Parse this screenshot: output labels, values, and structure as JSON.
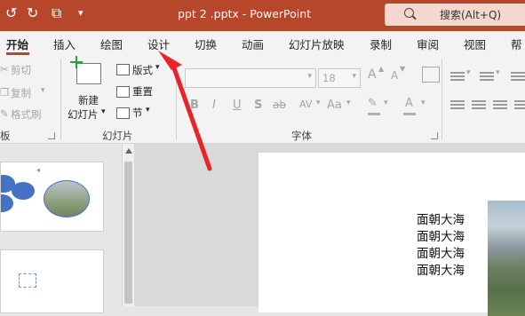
{
  "titlebar": {
    "title": "ppt 2 .pptx  -  PowerPoint",
    "search_label": "搜索(Alt+Q)",
    "save_icon": "save-icon",
    "redo_icon": "redo-icon",
    "present_icon": "present-from-start-icon",
    "customize_icon": "customize-toolbar-icon",
    "accent": "#b7472a"
  },
  "tabs": [
    "开始",
    "插入",
    "绘图",
    "设计",
    "切换",
    "动画",
    "幻灯片放映",
    "录制",
    "审阅",
    "视图",
    "帮"
  ],
  "active_tab": "开始",
  "ribbon": {
    "clipboard": {
      "cut": "剪切",
      "copy": "复制",
      "format_painter": "格式刷",
      "group_label": "板"
    },
    "slides": {
      "new_slide_line1": "新建",
      "new_slide_line2": "幻灯片",
      "layout": "版式",
      "reset": "重置",
      "section": "节",
      "group_label": "幻灯片"
    },
    "font": {
      "font_size": "18",
      "bold": "B",
      "italic": "I",
      "underline": "U",
      "shadow": "S",
      "strike": "ab",
      "spacing": "AV",
      "case": "Aa",
      "grow": "A",
      "shrink": "A",
      "font_color": "A",
      "group_label": "字体"
    }
  },
  "slide": {
    "lines": [
      "面朝大海",
      "面朝大海",
      "面朝大海",
      "面朝大海"
    ]
  },
  "annotation": {
    "arrow_color": "#e8232a"
  }
}
